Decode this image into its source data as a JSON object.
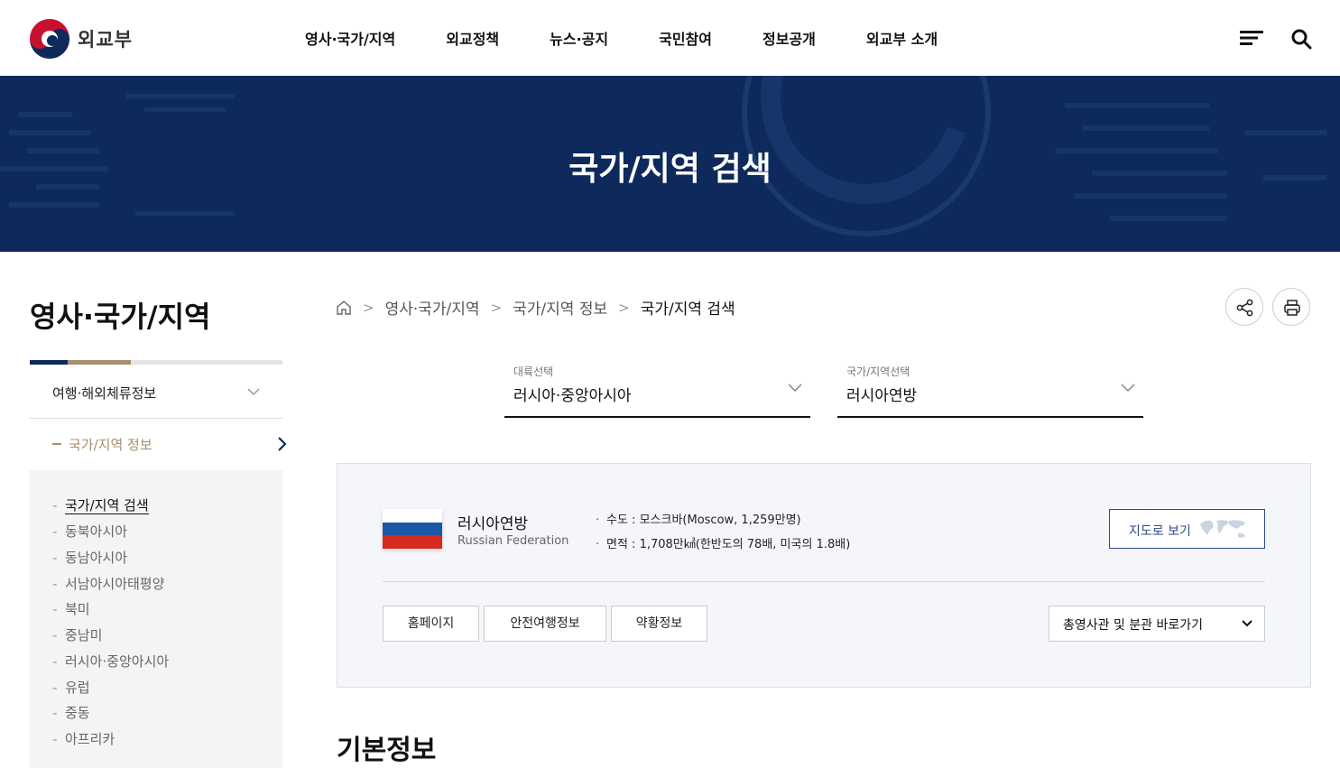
{
  "header": {
    "logo_text": "외교부",
    "nav": [
      "영사·국가/지역",
      "외교정책",
      "뉴스·공지",
      "국민참여",
      "정보공개",
      "외교부 소개"
    ]
  },
  "banner": {
    "title": "국가/지역 검색"
  },
  "sidebar": {
    "title": "영사·국가/지역",
    "depth1": "여행·해외체류정보",
    "depth2": "국가/지역 정보",
    "items": [
      "국가/지역 검색",
      "동북아시아",
      "동남아시아",
      "서남아시아태평양",
      "북미",
      "중남미",
      "러시아·중앙아시아",
      "유럽",
      "중동",
      "아프리카"
    ]
  },
  "breadcrumb": [
    "영사·국가/지역",
    "국가/지역 정보",
    "국가/지역 검색"
  ],
  "filters": {
    "continent": {
      "caption": "대륙선택",
      "value": "러시아·중앙아시아"
    },
    "country": {
      "caption": "국가/지역선택",
      "value": "러시아연방"
    }
  },
  "country": {
    "name": "러시아연방",
    "name_en": "Russian Federation",
    "capital": "수도 : 모스크바(Moscow, 1,259만명)",
    "area": "면적 : 1,708만㎢(한반도의 78배, 미국의 1.8배)",
    "flag_colors": [
      "#ffffff",
      "#1c57a5",
      "#d52b1e"
    ],
    "map_button": "지도로 보기",
    "buttons": [
      "홈페이지",
      "안전여행정보",
      "약황정보"
    ],
    "embassy_select": "총영사관 및 분관 바로가기"
  },
  "section": {
    "title": "기본정보"
  },
  "colors": {
    "navy": "#0e2a5c",
    "gold": "#a58f6d"
  }
}
